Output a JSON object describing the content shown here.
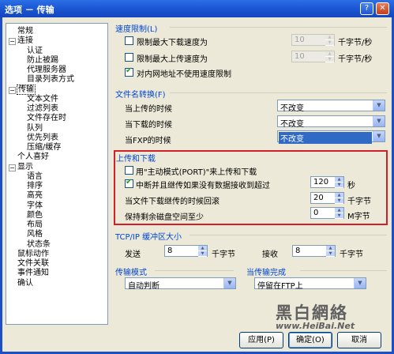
{
  "window": {
    "title": "选项 － 传输",
    "help_btn": "?",
    "close_btn": "✕"
  },
  "tree": {
    "items": [
      {
        "label": "常规",
        "level": 0,
        "toggle": ""
      },
      {
        "label": "连接",
        "level": 0,
        "toggle": "−"
      },
      {
        "label": "认证",
        "level": 1,
        "toggle": ""
      },
      {
        "label": "防止被踢",
        "level": 1,
        "toggle": ""
      },
      {
        "label": "代理服务器",
        "level": 1,
        "toggle": ""
      },
      {
        "label": "目录列表方式",
        "level": 1,
        "toggle": ""
      },
      {
        "label": "传输",
        "level": 0,
        "toggle": "−",
        "selected": true
      },
      {
        "label": "文本文件",
        "level": 1,
        "toggle": ""
      },
      {
        "label": "过滤列表",
        "level": 1,
        "toggle": ""
      },
      {
        "label": "文件存在时",
        "level": 1,
        "toggle": ""
      },
      {
        "label": "队列",
        "level": 1,
        "toggle": ""
      },
      {
        "label": "优先列表",
        "level": 1,
        "toggle": ""
      },
      {
        "label": "压缩/缓存",
        "level": 1,
        "toggle": ""
      },
      {
        "label": "个人喜好",
        "level": 0,
        "toggle": ""
      },
      {
        "label": "显示",
        "level": 0,
        "toggle": "−"
      },
      {
        "label": "语言",
        "level": 1,
        "toggle": ""
      },
      {
        "label": "排序",
        "level": 1,
        "toggle": ""
      },
      {
        "label": "高亮",
        "level": 1,
        "toggle": ""
      },
      {
        "label": "字体",
        "level": 1,
        "toggle": ""
      },
      {
        "label": "颜色",
        "level": 1,
        "toggle": ""
      },
      {
        "label": "布局",
        "level": 1,
        "toggle": ""
      },
      {
        "label": "风格",
        "level": 1,
        "toggle": ""
      },
      {
        "label": "状态条",
        "level": 1,
        "toggle": ""
      },
      {
        "label": "鼠标动作",
        "level": 0,
        "toggle": ""
      },
      {
        "label": "文件关联",
        "level": 0,
        "toggle": ""
      },
      {
        "label": "事件通知",
        "level": 0,
        "toggle": ""
      },
      {
        "label": "确认",
        "level": 0,
        "toggle": ""
      }
    ]
  },
  "speed_limit": {
    "title": "速度限制(L)",
    "download": {
      "label": "限制最大下载速度为",
      "checked": false,
      "value": "10",
      "unit": "千字节/秒"
    },
    "upload": {
      "label": "限制最大上传速度为",
      "checked": false,
      "value": "10",
      "unit": "千字节/秒"
    },
    "lan": {
      "label": "对内网地址不使用速度限制",
      "checked": true
    }
  },
  "file_name_convert": {
    "title": "文件名转换(F)",
    "upload": {
      "label": "当上传的时候",
      "value": "不改变"
    },
    "download": {
      "label": "当下载的时候",
      "value": "不改变"
    },
    "fxp": {
      "label": "当FXP的时候",
      "value": "不改变"
    }
  },
  "upload_download": {
    "title": "上传和下载",
    "port_mode": {
      "label": "用\"主动模式(PORT)\"来上传和下载",
      "checked": false
    },
    "interrupt": {
      "label": "中断并且继传如果没有数据接收到超过",
      "checked": true,
      "value": "120",
      "unit": "秒"
    },
    "resume_rollback": {
      "label": "当文件下载继传的时候回滚",
      "value": "20",
      "unit": "千字节"
    },
    "keep_free": {
      "label": "保持剩余磁盘空间至少",
      "value": "0",
      "unit": "M字节"
    }
  },
  "tcp_buffer": {
    "title": "TCP/IP 缓冲区大小",
    "send": {
      "label": "发送",
      "value": "8",
      "unit": "千字节"
    },
    "receive": {
      "label": "接收",
      "value": "8",
      "unit": "千字节"
    }
  },
  "transfer_mode": {
    "title": "传输模式",
    "value": "自动判断"
  },
  "on_complete": {
    "title": "当传输完成",
    "value": "停留在FTP上"
  },
  "buttons": {
    "apply": "应用(P)",
    "ok": "确定(O)",
    "cancel": "取消"
  },
  "watermark": {
    "cn": "黑白網絡",
    "url": "www.HeiBai.Net"
  }
}
